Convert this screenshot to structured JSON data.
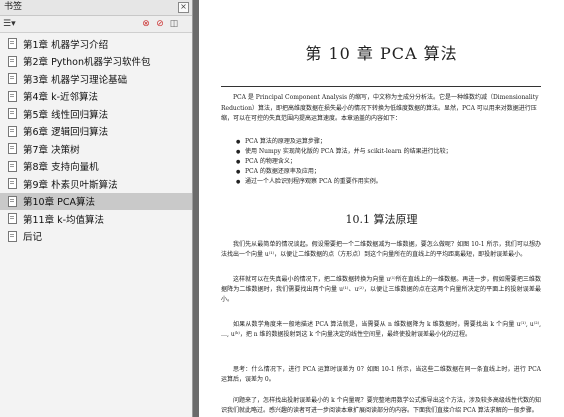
{
  "sidebar": {
    "title": "书签",
    "close_label": "×",
    "toolbar": {
      "menu_glyph": "☰▾",
      "icon1": "⊗",
      "icon2": "⊘",
      "icon3": "◫"
    },
    "items": [
      {
        "label": "第1章 机器学习介绍"
      },
      {
        "label": "第2章 Python机器学习软件包"
      },
      {
        "label": "第3章 机器学习理论基础"
      },
      {
        "label": "第4章 k-近邻算法"
      },
      {
        "label": "第5章 线性回归算法"
      },
      {
        "label": "第6章 逻辑回归算法"
      },
      {
        "label": "第7章 决策树"
      },
      {
        "label": "第8章 支持向量机"
      },
      {
        "label": "第9章 朴素贝叶斯算法"
      },
      {
        "label": "第10章 PCA算法",
        "selected": true
      },
      {
        "label": "第11章 k-均值算法"
      },
      {
        "label": "后记"
      }
    ]
  },
  "page": {
    "chapter_title": "第 10 章    PCA 算法",
    "intro": "PCA 是 Principal Component Analysis 的缩写，中文称为主成分分析法。它是一种维数约减（Dimensionality Reduction）算法，即把高维度数据在损失最小的情况下转换为低维度数据的算法。显然，PCA 可以用来对数据进行压缩，可以在可控的失真范围内提高运算速度。本章涵盖的内容如下：",
    "bullets": [
      "PCA 算法的原理及运算步骤；",
      "使用 Numpy 实现简化版的 PCA 算法，并与 scikit-learn 的结果进行比较；",
      "PCA 的物理含义；",
      "PCA 的数据还原率及应用；",
      "通过一个人脸识别程序观察 PCA 的重要作用实例。"
    ],
    "section_title": "10.1    算法原理",
    "p1": "我们先从最简单的情况谈起。假设需要把一个二维数据减为一维数据，要怎么做呢？如图 10-1 所示，我们可以想办法找出一个向量 u⁽¹⁾，以便让二维数据的点（方形点）到这个向量所在的直线上的平均距离最短，即投射误差最小。",
    "p2": "这样就可以在失真最小的情况下，把二维数据转换为向量 u⁽¹⁾所在直线上的一维数据。再进一步，假如需要把三维数据降为二维数据时，我们需要找出两个向量 u⁽¹⁾、u⁽²⁾，以便让三维数据的点在这两个向量所决定的平面上的投射误差最小。",
    "p3": "如果从数学角度来一般地描述 PCA 算法就是，当需要从 n 维数据降为 k 维数据时，需要找出 k 个向量 u⁽¹⁾, u⁽²⁾, …, u⁽ᵏ⁾，把 n 维的数据投射到这 k 个向量决定的线性空间里，最终使投射误差最小化的过程。",
    "p4": "思考：什么情况下，进行 PCA 运算时误差为 0？如图 10-1 所示，当这些二维数据在同一条直线上时，进行 PCA 运算后，误差为 0。",
    "p5": "问题来了，怎样找出投射误差最小的 k 个向量呢？要完整地用数学公式推导出这个方法，涉及较多高级线性代数的知识我们就此略过。感兴趣的读者可进一步阅读本章扩展阅读部分的内容。下面我们直接介绍 PCA 算法求解的一般步骤。"
  }
}
